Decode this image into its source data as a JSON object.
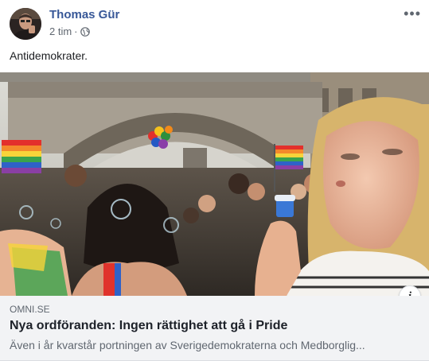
{
  "post": {
    "author": "Thomas Gür",
    "timestamp": "2 tim",
    "separator": "·",
    "audience_icon": "globe-icon",
    "more_icon": "more-options-icon",
    "more_label": "•••",
    "text": "Antidemokrater."
  },
  "link": {
    "domain": "OMNI.SE",
    "title": "Nya ordföranden: Ingen rättighet att gå i Pride",
    "description": "Även i år kvarstår portningen av Sverigedemokraterna och Medborglig...",
    "info_icon": "info-icon",
    "info_label": "i"
  },
  "colors": {
    "author_link": "#385898",
    "meta_text": "#606770",
    "caption_bg": "#f2f3f5"
  }
}
